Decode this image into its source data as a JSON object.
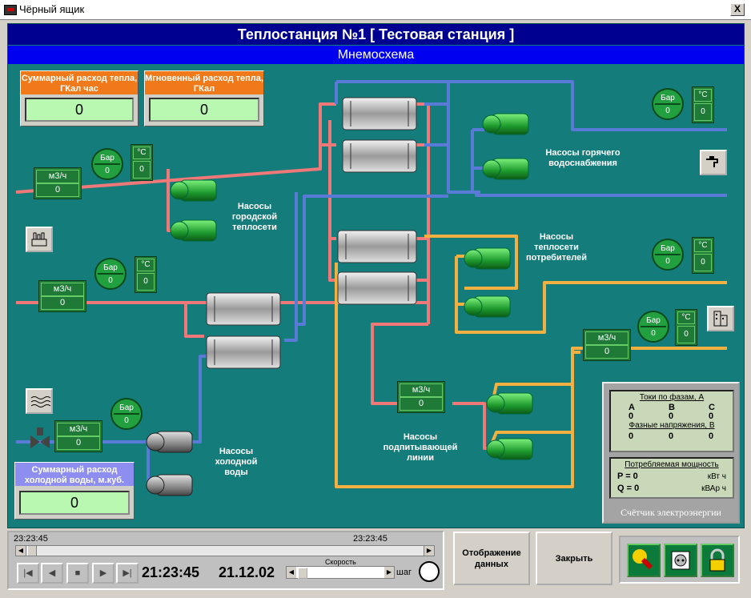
{
  "window": {
    "title": "Чёрный ящик",
    "close": "X"
  },
  "header": {
    "station": "Теплостанция №1  [ Тестовая станция ]",
    "view": "Мнемосхема"
  },
  "panels": {
    "heat_total": {
      "title": "Суммарный расход тепла, ГКал  час",
      "value": "0",
      "color": "#f07a1a"
    },
    "heat_instant": {
      "title": "Мгновенный расход тепла, ГКал",
      "value": "0",
      "color": "#f07a1a"
    },
    "cold_water_total": {
      "title": "Суммарный расход холодной воды, м.куб.",
      "value": "0",
      "color": "#8e8ef0"
    }
  },
  "labels": {
    "pumps_city": "Насосы городской теплосети",
    "pumps_hot": "Насосы горячего водоснабжения",
    "pumps_consumers": "Насосы теплосети потребителей",
    "pumps_makeup": "Насосы подпитывающей линии",
    "pumps_cold": "Насосы холодной воды"
  },
  "units": {
    "flow": "м3/ч",
    "pressure": "Бар",
    "temperature": "°С"
  },
  "readings": {
    "flow_city": "0",
    "p_city": "0",
    "t_city": "0",
    "flow_mid": "0",
    "p_mid": "0",
    "t_mid": "0",
    "flow_cold": "0",
    "p_cold": "0",
    "p_hot": "0",
    "t_hot": "0",
    "p_cons": "0",
    "t_cons": "0",
    "flow_right": "0",
    "p_right": "0",
    "t_right": "0",
    "flow_makeup": "0"
  },
  "energy_meter": {
    "currents_title": "Токи по фазам, А",
    "phases": [
      "A",
      "B",
      "C"
    ],
    "currents": [
      "0",
      "0",
      "0"
    ],
    "voltage_title": "Фазные напряжения, В",
    "voltages": [
      "0",
      "0",
      "0"
    ],
    "power_title": "Потребляемая мощность",
    "p_label": "P = 0",
    "p_unit": "кВт ч",
    "q_label": "Q = 0",
    "q_unit": "кВАр ч",
    "caption": "Счётчик электроэнергии"
  },
  "playback": {
    "time_start": "23:23:45",
    "time_end": "23:23:45",
    "clock": "21:23:45",
    "date": "21.12.02",
    "speed_label": "Скорость",
    "step_label": "шаг"
  },
  "buttons": {
    "display_data": "Отображение данных",
    "close": "Закрыть"
  }
}
